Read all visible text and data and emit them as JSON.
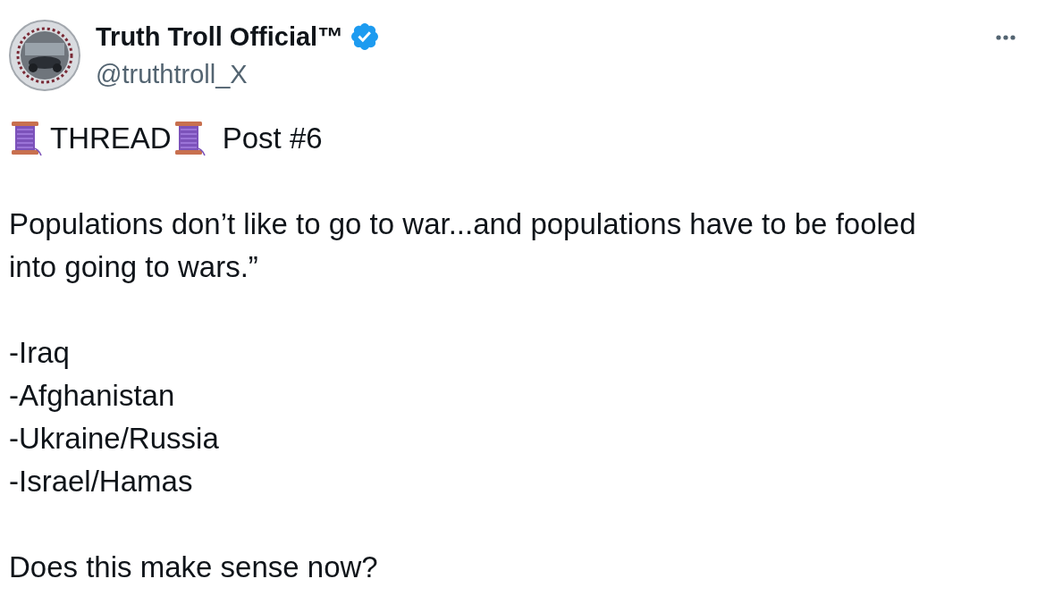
{
  "author": {
    "name": "Truth Troll Official™",
    "verified": true,
    "handle": "@truthtroll_X"
  },
  "post": {
    "paragraphs": [
      {
        "kind": "header",
        "segments": [
          {
            "kind": "spool"
          },
          {
            "kind": "text",
            "text": "THREAD"
          },
          {
            "kind": "spool"
          },
          {
            "kind": "text",
            "text": "Post #6"
          }
        ]
      },
      {
        "kind": "text",
        "text": "Populations don’t like to go to war...and populations have to be fooled into going to wars.”"
      },
      {
        "kind": "list",
        "items": [
          "-Iraq",
          "-Afghanistan",
          "-Ukraine/Russia",
          "-Israel/Hamas"
        ]
      },
      {
        "kind": "text",
        "text": "Does this make sense now?"
      }
    ]
  }
}
